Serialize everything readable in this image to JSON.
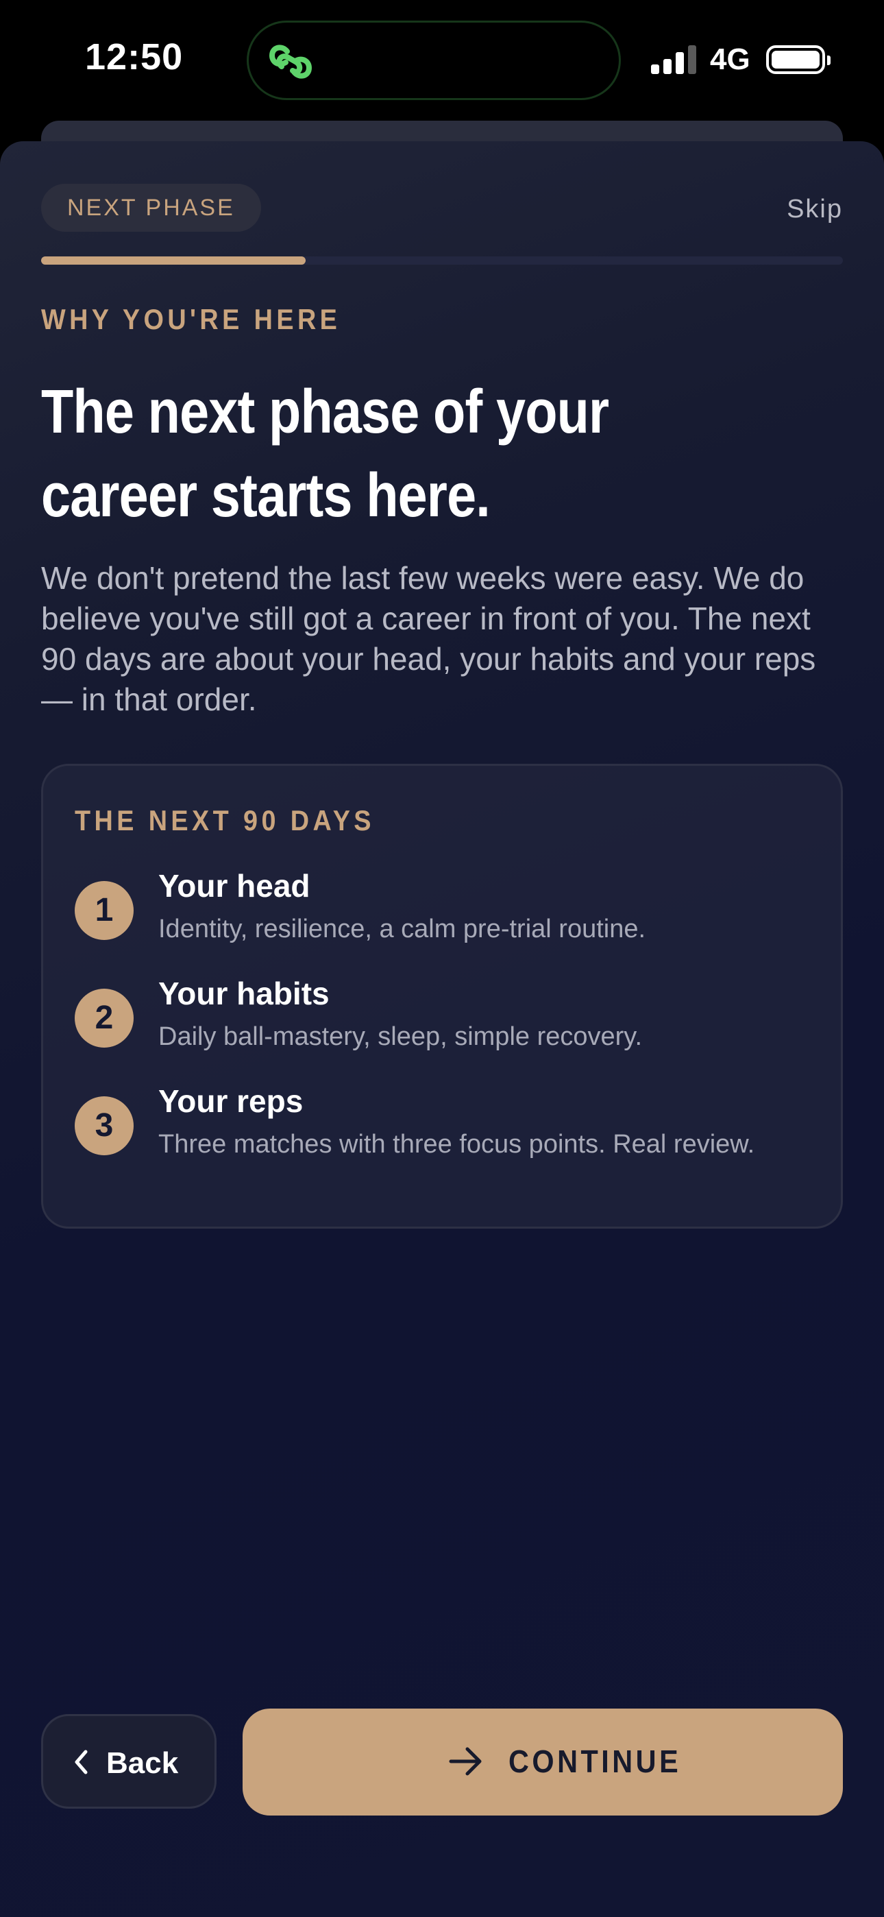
{
  "status_bar": {
    "time": "12:50",
    "network": "4G",
    "island_icon": "link-icon",
    "accent": "#5ed36a"
  },
  "header": {
    "pill_label": "NEXT PHASE",
    "skip_label": "Skip",
    "progress_fraction": 0.33
  },
  "intro": {
    "eyebrow": "WHY YOU'RE HERE",
    "headline": "The next phase of your career starts here.",
    "body": "We don't pretend the last few weeks were easy. We do believe you've still got a career in front of you. The next 90 days are about your head, your habits and your reps — in that order."
  },
  "plan_card": {
    "title": "THE NEXT 90 DAYS",
    "items": [
      {
        "number": "1",
        "title": "Your head",
        "description": "Identity, resilience, a calm pre-trial routine."
      },
      {
        "number": "2",
        "title": "Your habits",
        "description": "Daily ball-mastery, sleep, simple recovery."
      },
      {
        "number": "3",
        "title": "Your reps",
        "description": "Three matches with three focus points. Real review."
      }
    ]
  },
  "footer": {
    "back_label": "Back",
    "continue_label": "CONTINUE"
  },
  "colors": {
    "accent": "#c9a47e",
    "background": "#111532",
    "text_primary": "#ffffff",
    "text_secondary": "#b8bac6"
  }
}
